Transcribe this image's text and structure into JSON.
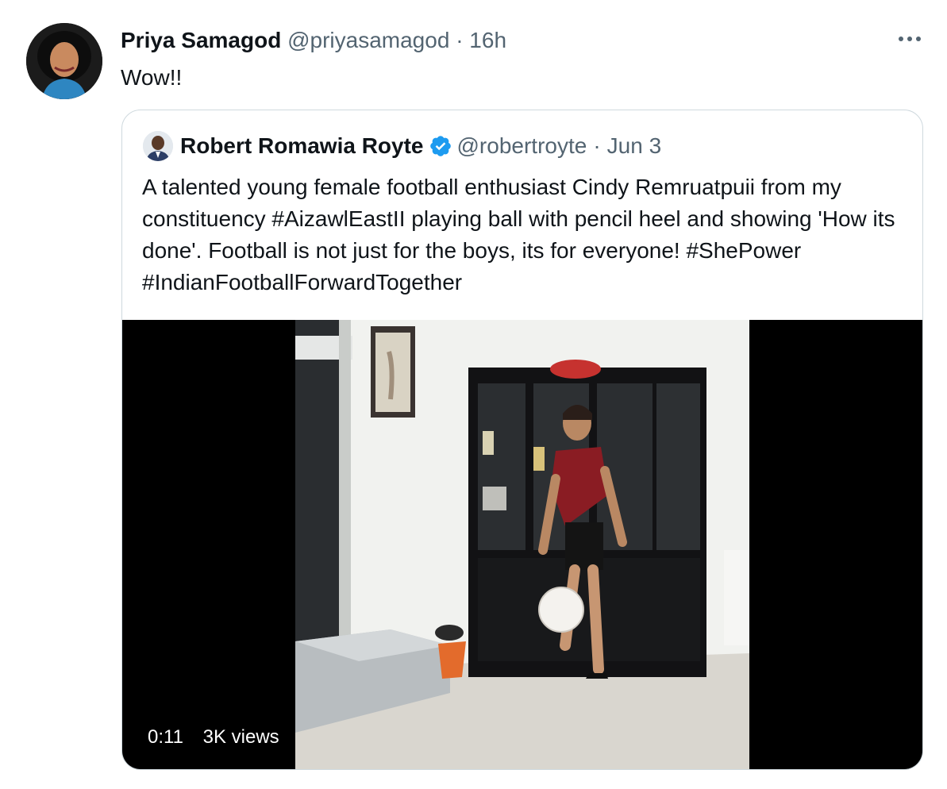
{
  "tweet": {
    "author_name": "Priya Samagod",
    "handle": "@priyasamagod",
    "separator": "·",
    "time": "16h",
    "text": "Wow!!",
    "more_icon": "more-horizontal-icon"
  },
  "quote": {
    "author_name": "Robert Romawia Royte",
    "verified_icon": "verified-badge-icon",
    "handle": "@robertroyte",
    "separator": "·",
    "time": "Jun 3",
    "text": "A talented young female football enthusiast Cindy Remruatpuii from my constituency #AizawlEastII playing ball with pencil heel and showing 'How its done'. Football is not just for the boys, its for everyone! #ShePower #IndianFootballForwardTogether",
    "video": {
      "duration": "0:11",
      "views": "3K views"
    }
  },
  "colors": {
    "text": "#0f1419",
    "secondary": "#536471",
    "border": "#cfd9de",
    "verified": "#1d9bf0"
  }
}
